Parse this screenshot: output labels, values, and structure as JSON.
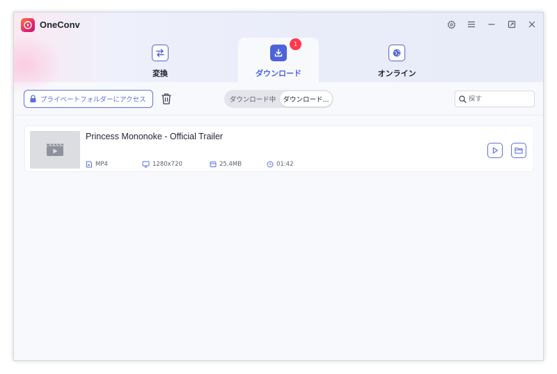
{
  "app": {
    "title": "OneConv",
    "brand_color": "#e5266b",
    "accent_color": "#5b6fe0"
  },
  "window_controls": [
    "settings-icon",
    "menu-icon",
    "minimize-icon",
    "maximize-icon",
    "close-icon"
  ],
  "tabs": [
    {
      "label": "変換",
      "icon": "convert-icon",
      "active": false
    },
    {
      "label": "ダウンロード",
      "icon": "download-icon",
      "active": true,
      "badge": "1"
    },
    {
      "label": "オンライン",
      "icon": "online-icon",
      "active": false
    }
  ],
  "toolbar": {
    "private_folder_label": "プライベートフォルダーにアクセス",
    "segment": {
      "downloading_label": "ダウンロード中",
      "downloaded_label": "ダウンロード..."
    },
    "search_placeholder": "探す"
  },
  "downloads": [
    {
      "title": "Princess Mononoke - Official Trailer",
      "format": "MP4",
      "resolution": "1280x720",
      "size": "25.4MB",
      "duration": "01:42"
    }
  ]
}
